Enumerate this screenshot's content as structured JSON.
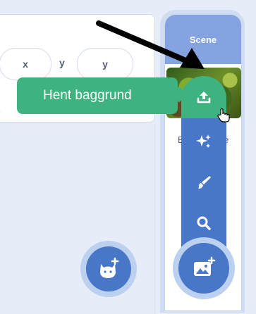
{
  "sprite_info": {
    "x_label": "x",
    "y_label": "y",
    "y_value": "y",
    "rotation_label_partial": "R"
  },
  "stage": {
    "header": "Scene",
    "backdrop_name_left": "B",
    "backdrop_name_right": "e"
  },
  "tooltip": {
    "text": "Hent baggrund"
  },
  "flyout": {
    "items": [
      {
        "label": "upload",
        "icon": "upload-icon"
      },
      {
        "label": "surprise",
        "icon": "sparkle-icon"
      },
      {
        "label": "paint",
        "icon": "paintbrush-icon"
      },
      {
        "label": "search",
        "icon": "search-icon"
      }
    ]
  },
  "buttons": {
    "choose_sprite_icon": "cat-plus-icon",
    "choose_backdrop_icon": "image-plus-icon"
  },
  "colors": {
    "accent_blue": "#4877c8",
    "accent_green": "#3fb37f",
    "header_blue": "#85a3e0",
    "background": "#e6edf8"
  }
}
